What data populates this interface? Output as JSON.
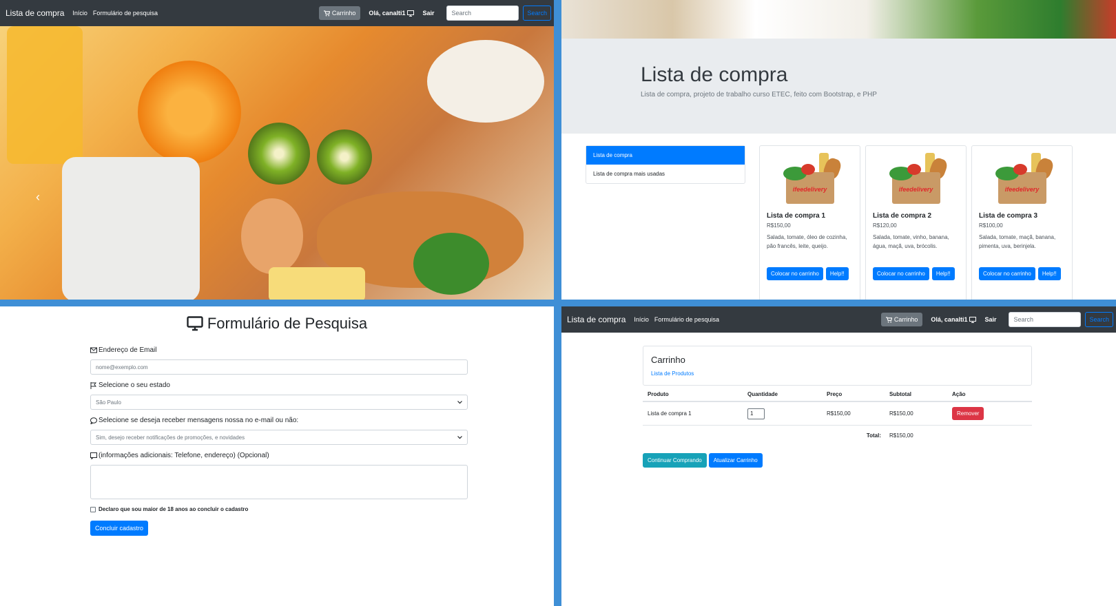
{
  "navbar": {
    "brand": "Lista de compra",
    "links": [
      "Início",
      "Formulário de pesquisa"
    ],
    "cart_label": "Carrinho",
    "greeting": "Olá, canalti1",
    "logout": "Sair",
    "search_placeholder": "Search",
    "search_button": "Search"
  },
  "hero": {
    "prev_glyph": "‹"
  },
  "products_page": {
    "jumbotron_title": "Lista de compra",
    "jumbotron_subtitle": "Lista de compra, projeto de trabalho curso ETEC, feito com Bootstrap, e PHP",
    "sidebar": [
      "Lista de compra",
      "Lista de compra mais usadas"
    ],
    "logo_text": "ifeedelivery",
    "cards": [
      {
        "title": "Lista de compra 1",
        "price": "R$150,00",
        "text": "Salada, tomate, óleo de cozinha, pão francês, leite, queijo.",
        "cart_btn": "Colocar no carrinho",
        "help_btn": "Help!!"
      },
      {
        "title": "Lista de compra 2",
        "price": "R$120,00",
        "text": "Salada, tomate, vinho, banana, água, maçã, uva, brócolis.",
        "cart_btn": "Colocar no carrinho",
        "help_btn": "Help!!"
      },
      {
        "title": "Lista de compra 3",
        "price": "R$100,00",
        "text": "Salada, tomate, maçã, banana, pimenta, uva, berinjela.",
        "cart_btn": "Colocar no carrinho",
        "help_btn": "Help!!"
      }
    ]
  },
  "form_page": {
    "title": "Formulário de Pesquisa",
    "email_label": "Endereço de Email",
    "email_placeholder": "nome@exemplo.com",
    "state_label": "Selecione o seu estado",
    "state_value": "São Paulo",
    "messages_label": "Selecione se deseja receber mensagens nossa no e-mail ou não:",
    "messages_value": "Sim, desejo receber notificações de promoções, e novidades",
    "info_label": "(informações adicionais: Telefone, endereço) (Opcional)",
    "checkbox_label": "Declaro que sou maior de 18 anos ao concluir o cadastro",
    "submit": "Concluir cadastro"
  },
  "cart_page": {
    "title": "Carrinho",
    "link": "Lista de Produtos",
    "headers": [
      "Produto",
      "Quantidade",
      "Preço",
      "Subtotal",
      "Ação"
    ],
    "row": {
      "product": "Lista de compra 1",
      "quantity": "1",
      "price": "R$150,00",
      "subtotal": "R$150,00",
      "action": "Remover"
    },
    "total_label": "Total:",
    "total_value": "R$150,00",
    "continue_btn": "Continuar Comprando",
    "update_btn": "Atualizar Carrinho"
  },
  "colors": {
    "divider": "#3f8fd6",
    "navbar": "#343a40",
    "primary": "#007bff",
    "danger": "#dc3545",
    "info": "#17a2b8"
  }
}
